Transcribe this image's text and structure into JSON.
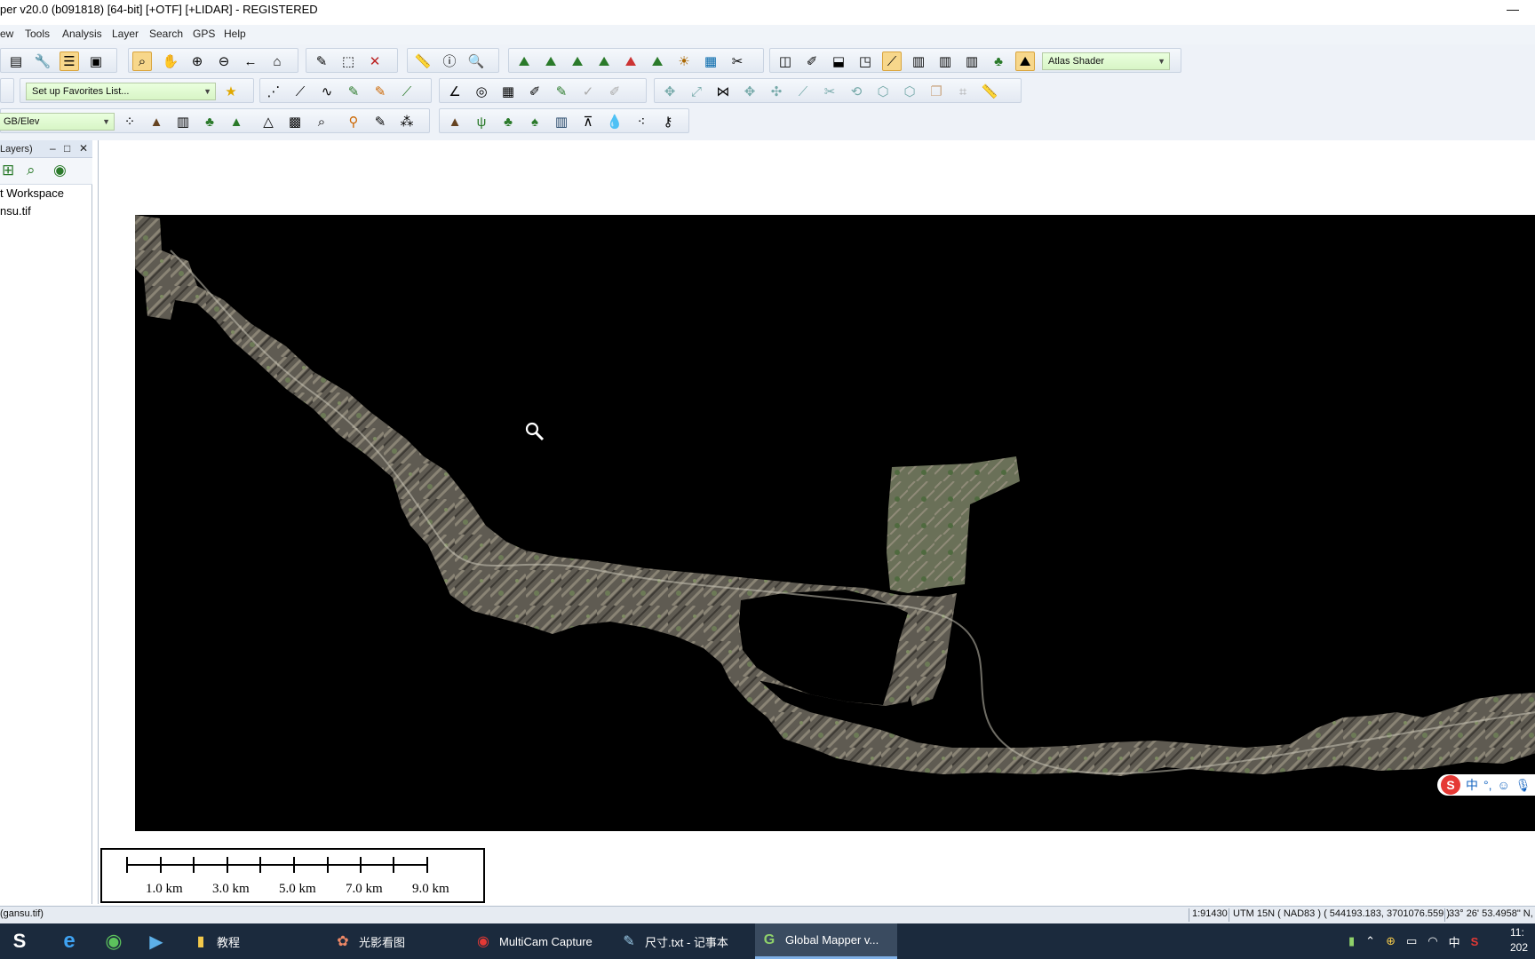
{
  "window": {
    "title": "per v20.0 (b091818) [64-bit] [+OTF] [+LIDAR] - REGISTERED",
    "minimize_glyph": "—"
  },
  "menu": [
    "ew",
    "Tools",
    "Analysis",
    "Layer",
    "Search",
    "GPS",
    "Help"
  ],
  "toolbar": {
    "shader_combo": "Atlas Shader",
    "favorites_combo": "Set up Favorites List...",
    "rgb_combo": "GB/Elev"
  },
  "layer_panel": {
    "header": "Layers)",
    "items": [
      "t Workspace",
      "nsu.tif"
    ]
  },
  "scale_bar": {
    "labels": [
      "1.0 km",
      "3.0 km",
      "5.0 km",
      "7.0 km",
      "9.0 km"
    ]
  },
  "status_bar": {
    "left": "(gansu.tif)",
    "scale": "1:91430",
    "projection": "UTM 15N ( NAD83 ) ( 544193.183, 3701076.559 )",
    "latlon": "33° 26' 53.4958\" N,"
  },
  "taskbar": {
    "tasks": [
      {
        "label": "教程",
        "icon": "folder-icon"
      },
      {
        "label": "光影看图",
        "icon": "photo-viewer-icon"
      },
      {
        "label": "MultiCam Capture",
        "icon": "multicam-icon"
      },
      {
        "label": "尺寸.txt - 记事本",
        "icon": "notepad-icon"
      },
      {
        "label": "Global Mapper v...",
        "icon": "global-mapper-icon"
      }
    ],
    "ime_indicator": "中",
    "clock_time": "11:",
    "clock_date": "202"
  },
  "ime_bar": {
    "lang": "中",
    "punct": "°,"
  },
  "colors": {
    "accent": "#f7d78b",
    "combo_green": "#d8f5c6",
    "taskbar": "#1b2a3d",
    "map_background": "#000000"
  }
}
